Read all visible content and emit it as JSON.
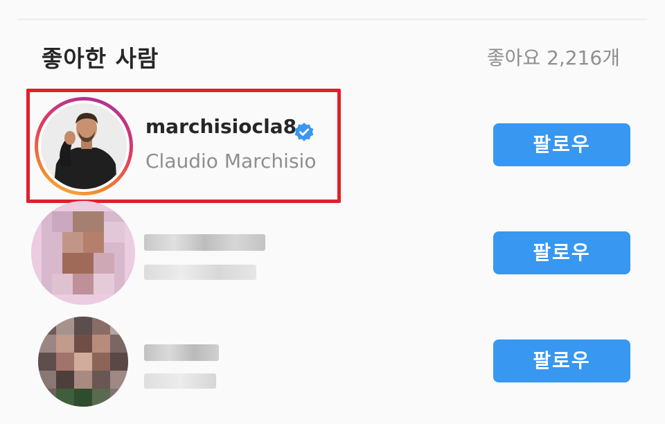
{
  "header": {
    "title": "좋아한 사람",
    "likes_count": "좋아요 2,216개"
  },
  "users": [
    {
      "username": "marchisiocla8",
      "full_name": "Claudio Marchisio",
      "verified": true,
      "highlighted": true,
      "follow_label": "팔로우"
    },
    {
      "username": "",
      "full_name": "",
      "verified": false,
      "highlighted": false,
      "pixelated": true,
      "follow_label": "팔로우"
    },
    {
      "username": "",
      "full_name": "",
      "verified": false,
      "highlighted": false,
      "pixelated": true,
      "follow_label": "팔로우"
    }
  ],
  "colors": {
    "follow_button": "#3897f0",
    "highlight_border": "#e0202b",
    "verified_badge": "#3897f0",
    "secondary_text": "#8e8e8e"
  }
}
